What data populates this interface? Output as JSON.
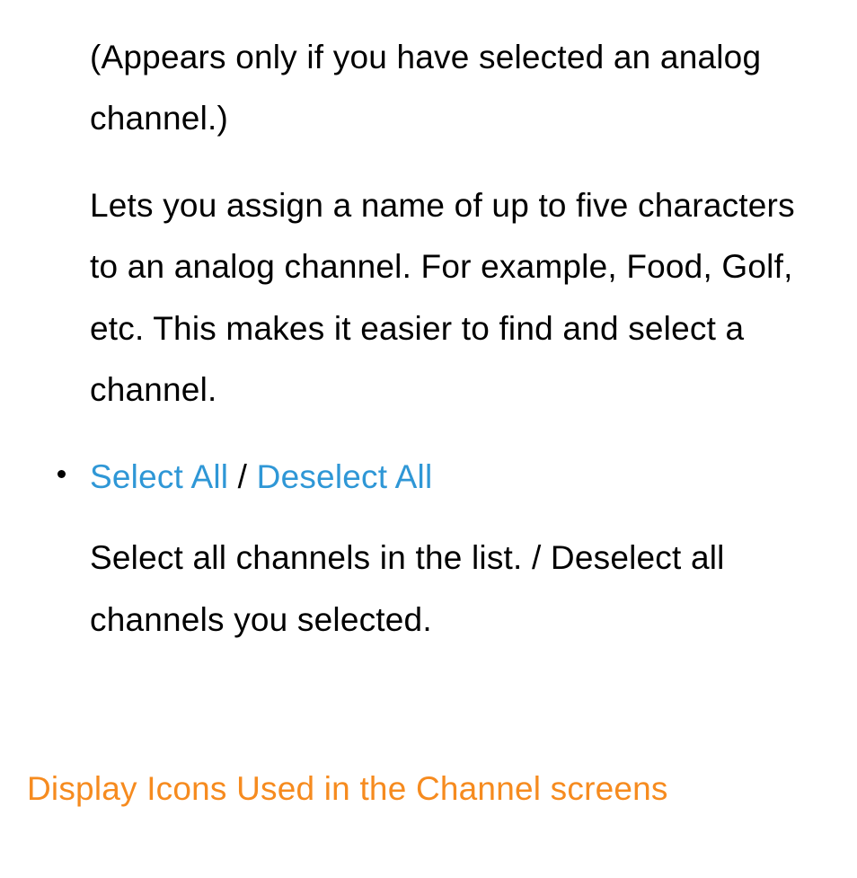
{
  "block1": {
    "note": "(Appears only if you have selected an analog channel.)",
    "desc": "Lets you assign a name of up to five characters to an analog channel. For example, Food, Golf, etc. This makes it easier to find and select a channel."
  },
  "bullet": {
    "link_select": "Select All",
    "separator": " / ",
    "link_deselect": "Deselect All",
    "desc": "Select all channels in the list. / Deselect all channels you selected."
  },
  "heading": "Display Icons Used in the Channel screens"
}
